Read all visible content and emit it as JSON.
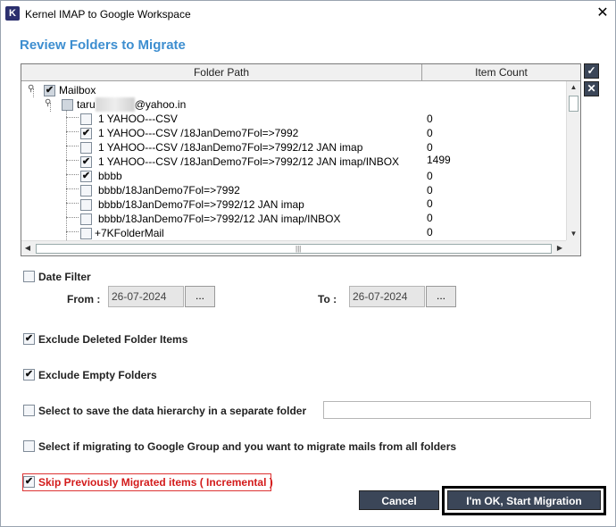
{
  "window": {
    "app_icon_letter": "K",
    "title": "Kernel IMAP to Google Workspace",
    "close_glyph": "✕"
  },
  "heading": "Review Folders to Migrate",
  "tree": {
    "columns": {
      "path": "Folder Path",
      "count": "Item Count"
    },
    "root": {
      "label": "Mailbox",
      "checked": true
    },
    "account": {
      "label_prefix": "taru",
      "label_masked": "        ",
      "label_suffix": "@yahoo.in",
      "checked": false
    },
    "folders": [
      {
        "label": "1 YAHOO---CSV",
        "checked": false,
        "count": "0"
      },
      {
        "label": "1 YAHOO---CSV /18JanDemo7Fol=>7992",
        "checked": true,
        "count": "0"
      },
      {
        "label": "1 YAHOO---CSV /18JanDemo7Fol=>7992/12 JAN imap",
        "checked": false,
        "count": "0"
      },
      {
        "label": "1 YAHOO---CSV /18JanDemo7Fol=>7992/12 JAN imap/INBOX",
        "checked": true,
        "count": "1499"
      },
      {
        "label": "bbbb",
        "checked": true,
        "count": "0"
      },
      {
        "label": "bbbb/18JanDemo7Fol=>7992",
        "checked": false,
        "count": "0"
      },
      {
        "label": "bbbb/18JanDemo7Fol=>7992/12 JAN imap",
        "checked": false,
        "count": "0"
      },
      {
        "label": "bbbb/18JanDemo7Fol=>7992/12 JAN imap/INBOX",
        "checked": false,
        "count": "0"
      },
      {
        "label": "+7KFolderMail",
        "checked": false,
        "count": "0"
      }
    ],
    "side_buttons": {
      "check_all_icon": "✓",
      "uncheck_all_icon": "✕"
    }
  },
  "options": {
    "date_filter": {
      "label": "Date Filter",
      "checked": false
    },
    "from_label": "From :",
    "from_value": "26-07-2024",
    "to_label": "To :",
    "to_value": "26-07-2024",
    "browse_label": "...",
    "exclude_deleted": {
      "label": "Exclude Deleted Folder Items",
      "checked": true
    },
    "exclude_empty": {
      "label": "Exclude Empty Folders",
      "checked": true
    },
    "save_hierarchy": {
      "label": "Select to save the data hierarchy in a separate folder",
      "checked": false,
      "value": ""
    },
    "google_group": {
      "label": "Select if migrating to Google Group and you want to migrate mails from all folders",
      "checked": false
    },
    "skip_migrated": {
      "label": "Skip Previously Migrated items ( Incremental )",
      "checked": true
    }
  },
  "buttons": {
    "cancel": "Cancel",
    "start": "I'm OK, Start Migration"
  },
  "colors": {
    "heading": "#3d8ed0",
    "button_bg": "#3b4658",
    "warning_text": "#d31b1b"
  }
}
